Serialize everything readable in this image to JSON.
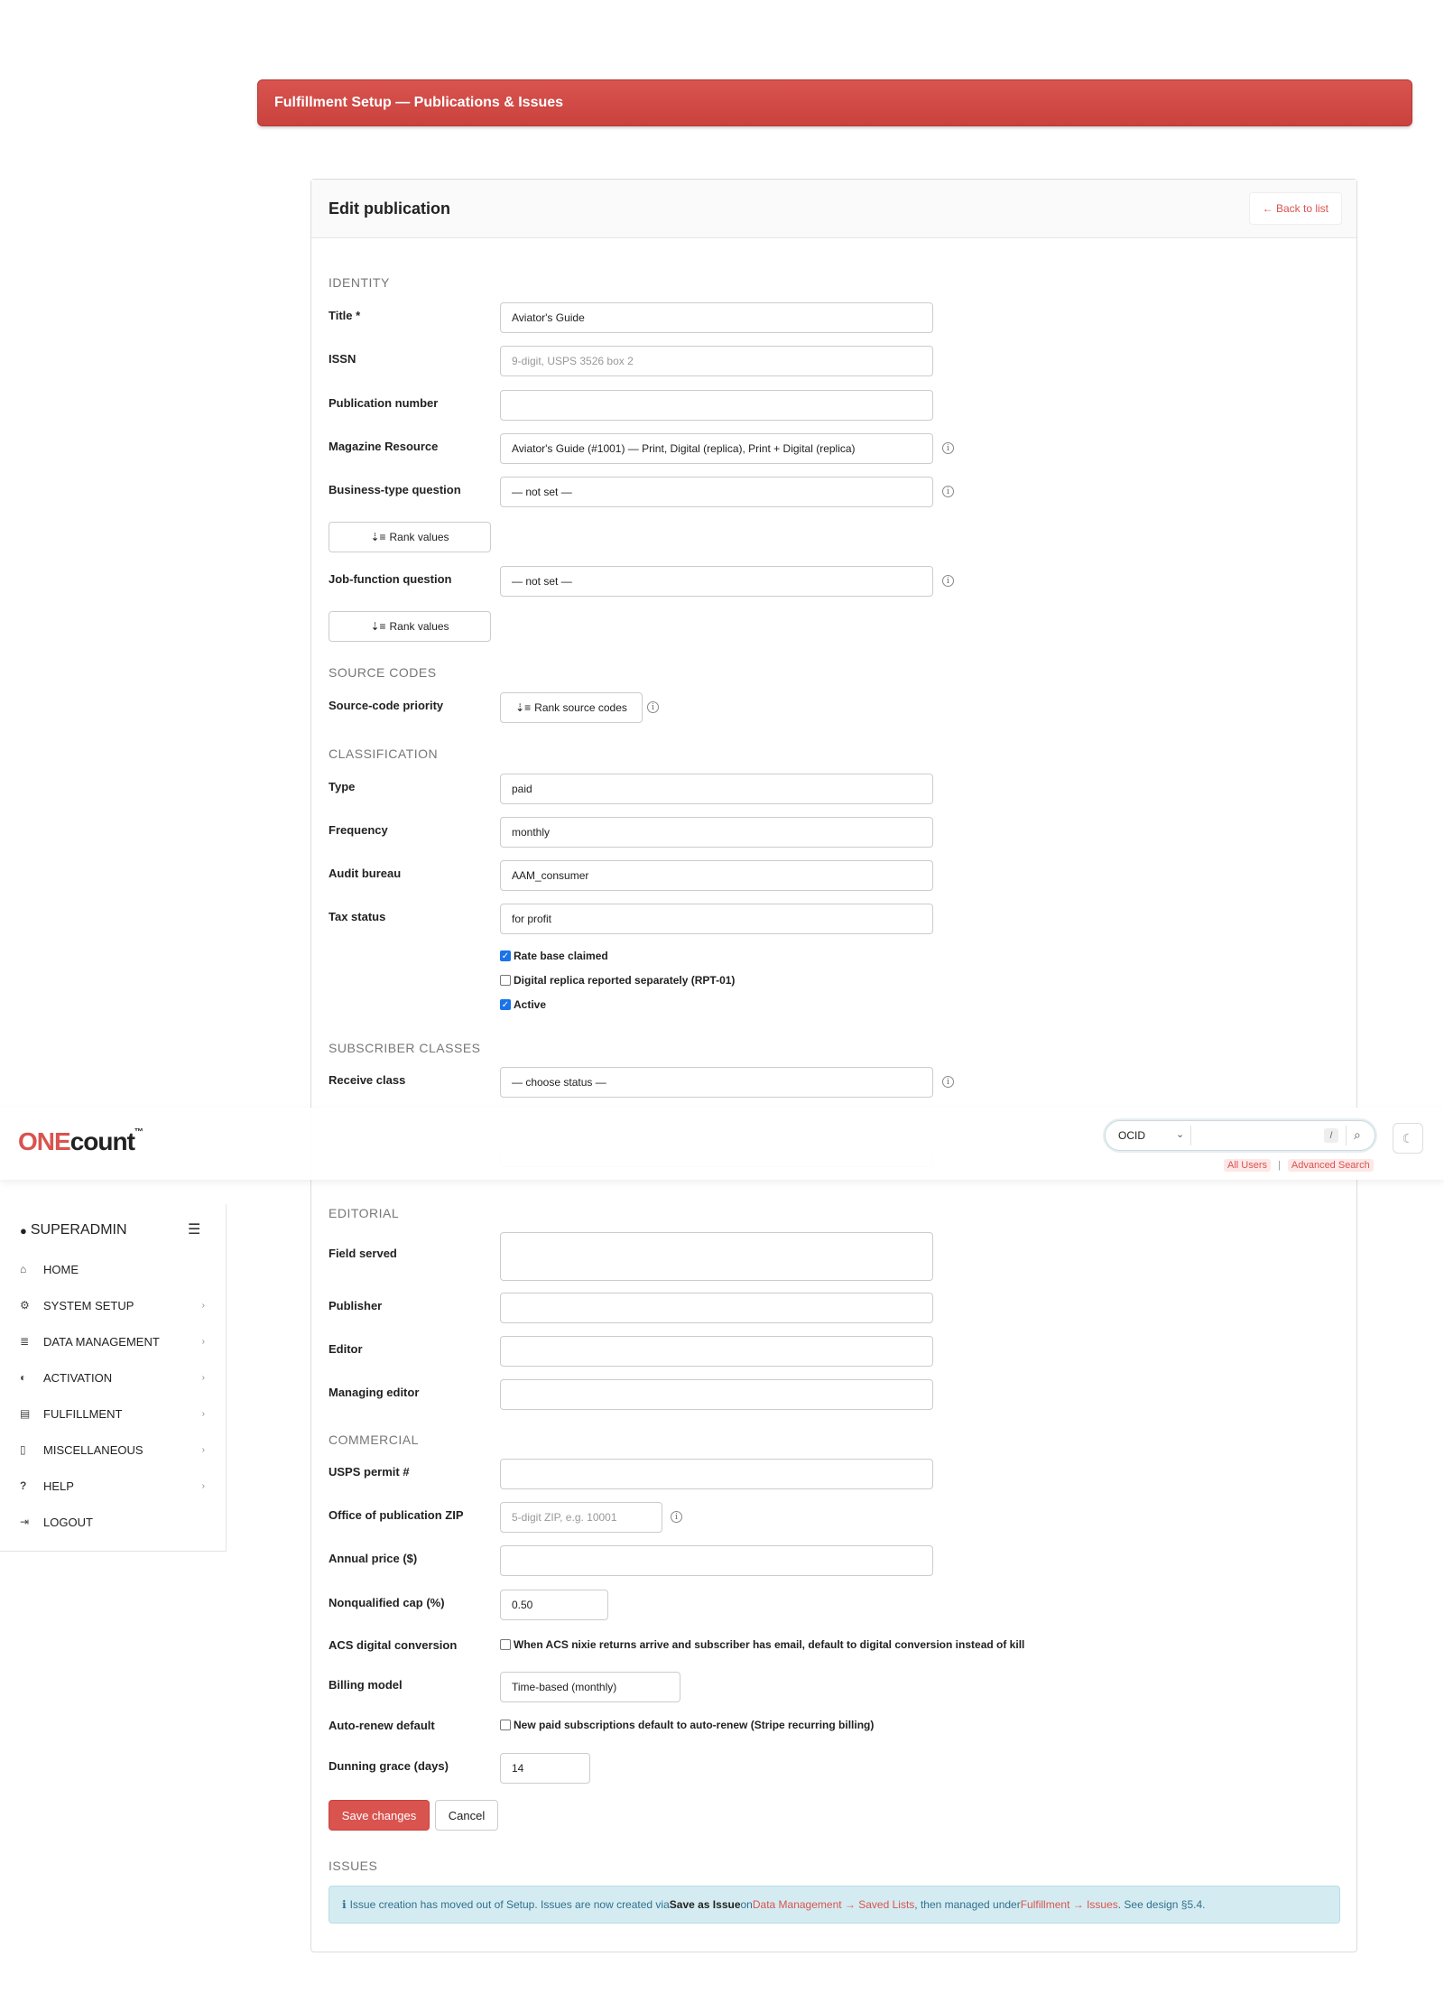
{
  "banner": {
    "title": "Fulfillment Setup — Publications & Issues"
  },
  "card": {
    "title": "Edit publication",
    "back_link": "← Back to list"
  },
  "sections": {
    "identity": "IDENTITY",
    "source_codes": "SOURCE CODES",
    "classification": "CLASSIFICATION",
    "subscriber_classes": "SUBSCRIBER CLASSES",
    "editorial": "EDITORIAL",
    "commercial": "COMMERCIAL",
    "issues": "ISSUES"
  },
  "identity": {
    "title_label": "Title *",
    "title_value": "Aviator's Guide",
    "issn_label": "ISSN",
    "issn_placeholder": "9-digit, USPS 3526 box 2",
    "pubnum_label": "Publication number",
    "pubnum_value": "",
    "magres_label": "Magazine Resource",
    "magres_value": "Aviator's Guide (#1001) — Print, Digital (replica), Print + Digital (replica)",
    "biz_label": "Business-type question",
    "biz_value": "— not set —",
    "rank_values_label": "Rank values",
    "job_label": "Job-function question",
    "job_value": "— not set —"
  },
  "source_codes": {
    "priority_label": "Source-code priority",
    "rank_button": "Rank source codes"
  },
  "classification": {
    "type_label": "Type",
    "type_value": "paid",
    "freq_label": "Frequency",
    "freq_value": "monthly",
    "audit_label": "Audit bureau",
    "audit_value": "AAM_consumer",
    "tax_label": "Tax status",
    "tax_value": "for profit",
    "checkboxes": [
      {
        "label": "Rate base claimed",
        "checked": true
      },
      {
        "label": "Digital replica reported separately (RPT-01)",
        "checked": false
      },
      {
        "label": "Active",
        "checked": true
      }
    ]
  },
  "subscriber_classes": {
    "receive_label": "Receive class",
    "receive_value": "— choose status —"
  },
  "editorial": {
    "field_served_label": "Field served",
    "publisher_label": "Publisher",
    "editor_label": "Editor",
    "managing_label": "Managing editor"
  },
  "commercial": {
    "usps_label": "USPS permit #",
    "zip_label": "Office of publication ZIP",
    "zip_placeholder": "5-digit ZIP, e.g. 10001",
    "price_label": "Annual price ($)",
    "nqcap_label": "Nonqualified cap (%)",
    "nqcap_value": "0.50",
    "acs_label": "ACS digital conversion",
    "acs_text": "When ACS nixie returns arrive and subscriber has email, default to digital conversion instead of kill",
    "billing_label": "Billing model",
    "billing_value": "Time-based (monthly)",
    "autorenew_label": "Auto-renew default",
    "autorenew_text": "New paid subscriptions default to auto-renew (Stripe recurring billing)",
    "dunning_label": "Dunning grace (days)",
    "dunning_value": "14"
  },
  "actions": {
    "save": "Save changes",
    "cancel": "Cancel"
  },
  "issues_alert": {
    "text1": "Issue creation has moved out of Setup. Issues are now created via ",
    "bold": "Save as Issue",
    "text2": " on ",
    "link1": "Data Management → Saved Lists",
    "text3": ", then managed under ",
    "link2": "Fulfillment → Issues",
    "text4": ". See design §5.4."
  },
  "topbar": {
    "logo_one": "ONE",
    "logo_count": "count",
    "logo_tm": "™",
    "search_select": "OCID",
    "search_hotkey": "/",
    "all_users": "All Users",
    "sep": "|",
    "advanced": "Advanced Search"
  },
  "sidebar": {
    "user": "SUPERADMIN",
    "items": [
      {
        "label": "HOME",
        "icon": "home-icon",
        "has_arrow": false
      },
      {
        "label": "SYSTEM SETUP",
        "icon": "gear-icon",
        "has_arrow": true
      },
      {
        "label": "DATA MANAGEMENT",
        "icon": "database-icon",
        "has_arrow": true
      },
      {
        "label": "ACTIVATION",
        "icon": "toggle-icon",
        "has_arrow": true
      },
      {
        "label": "FULFILLMENT",
        "icon": "newspaper-icon",
        "has_arrow": true
      },
      {
        "label": "MISCELLANEOUS",
        "icon": "file-icon",
        "has_arrow": true
      },
      {
        "label": "HELP",
        "icon": "question-icon",
        "has_arrow": true
      },
      {
        "label": "LOGOUT",
        "icon": "logout-icon",
        "has_arrow": false
      }
    ]
  },
  "colors": {
    "accent": "#d9534f",
    "info_bg": "#d4ecf1",
    "checkbox": "#1a73e8"
  }
}
